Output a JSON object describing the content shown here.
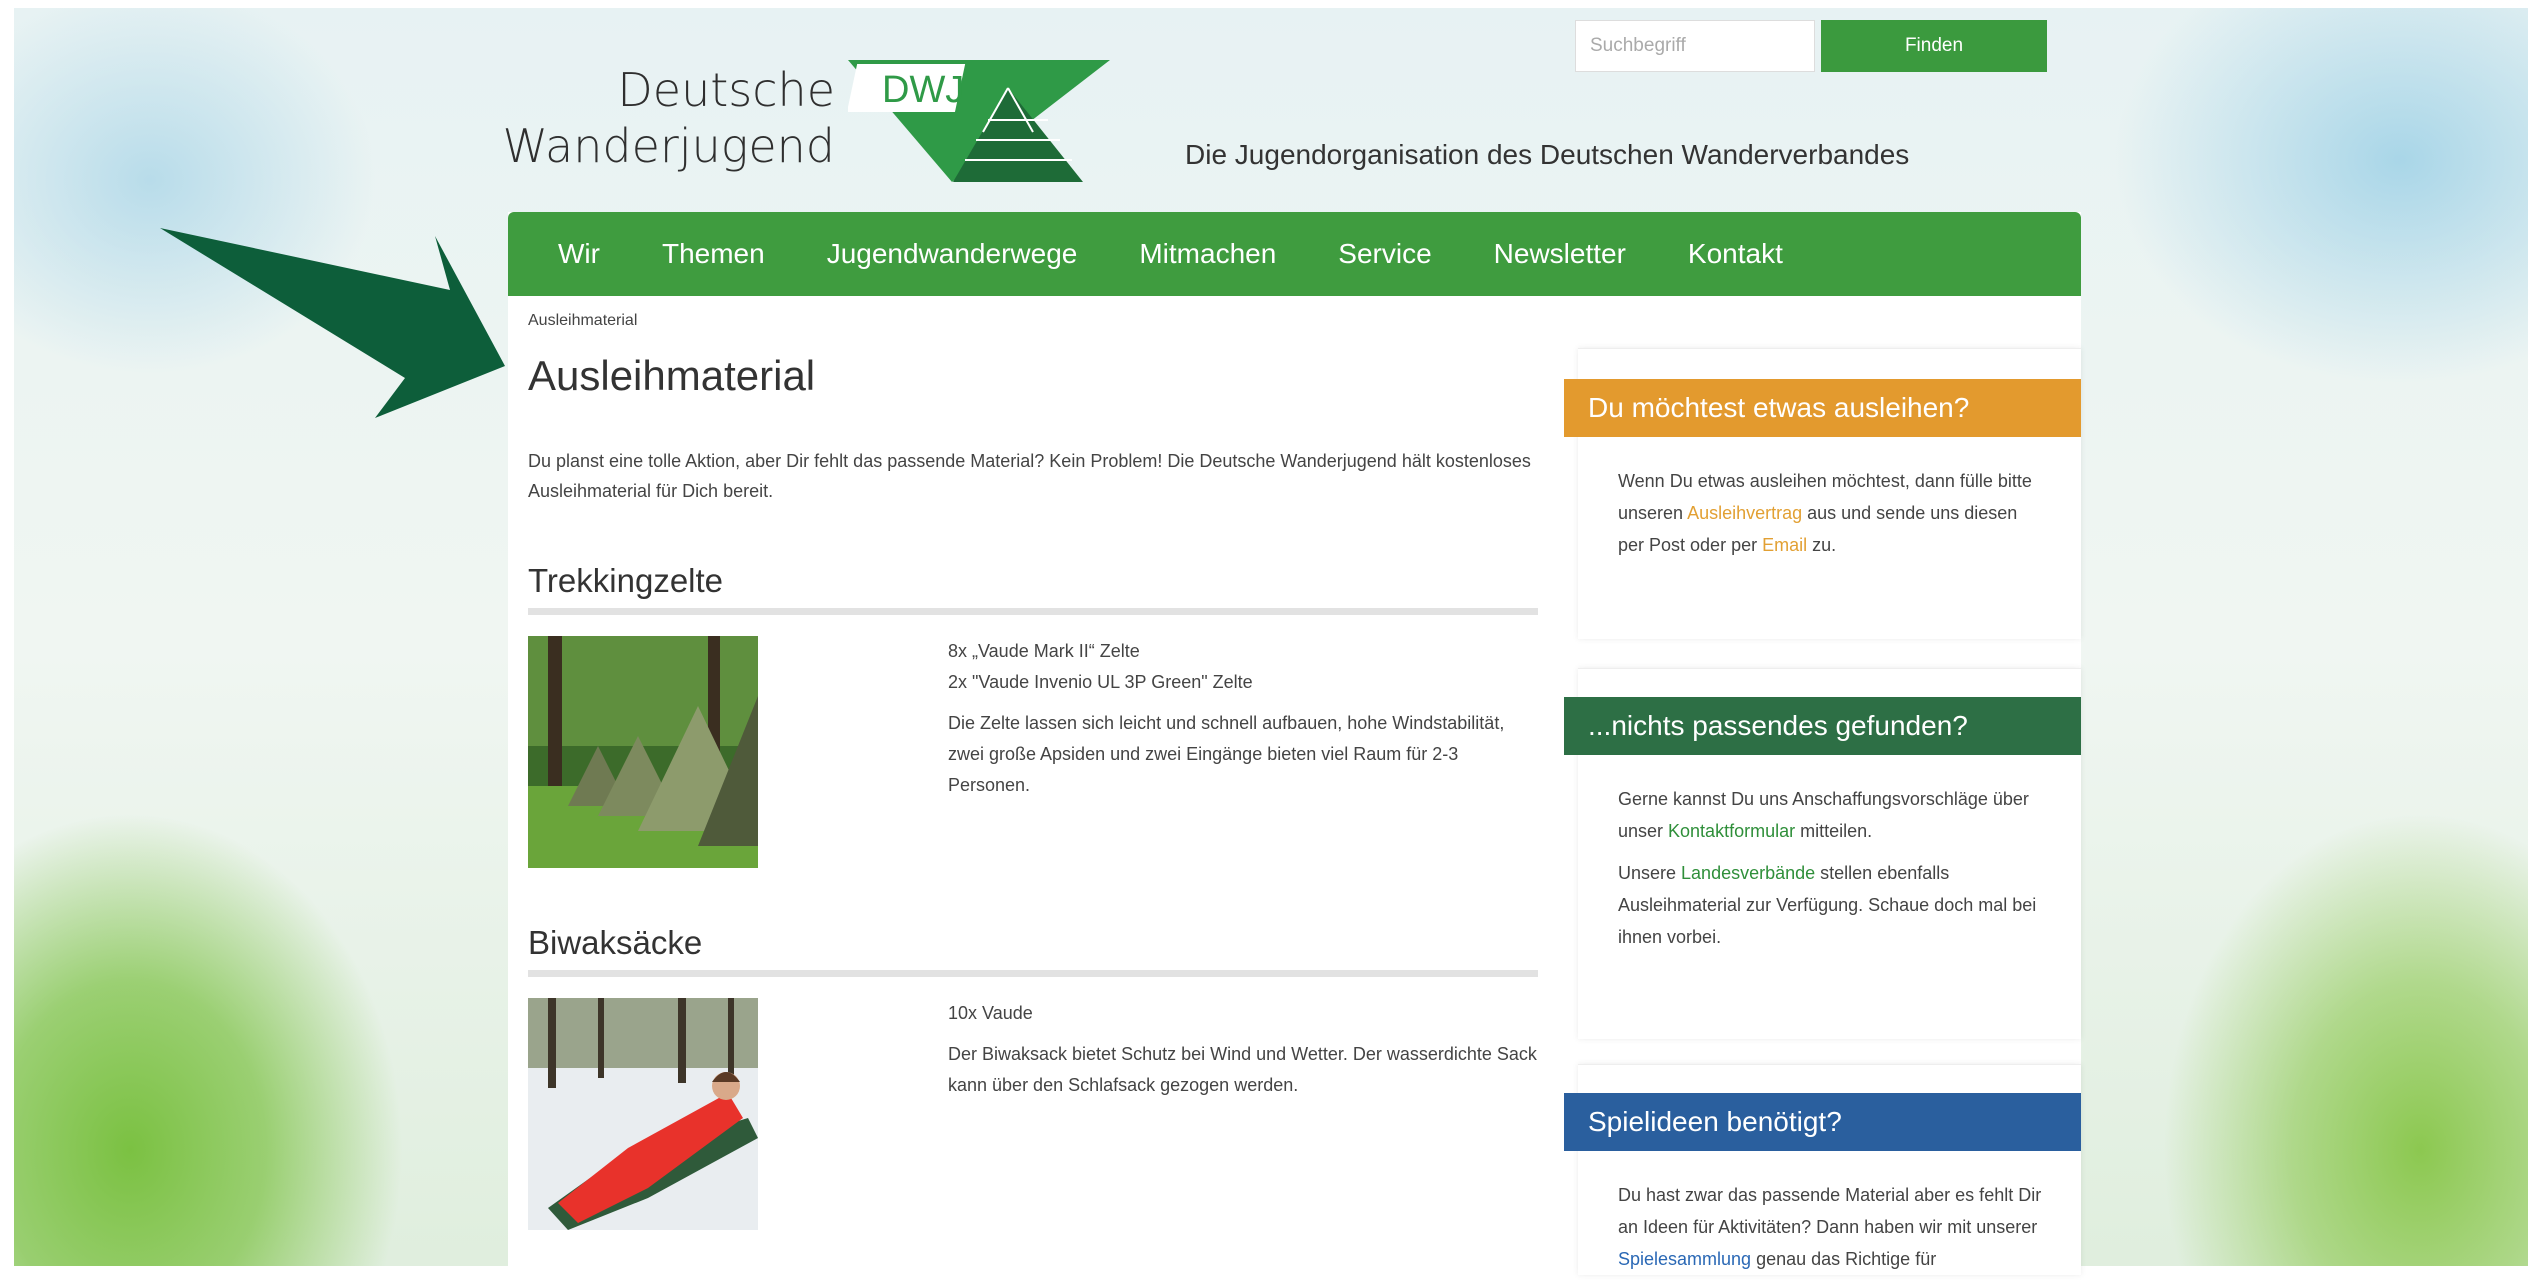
{
  "header": {
    "search_placeholder": "Suchbegriff",
    "search_button": "Finden",
    "logo_line1": "Deutsche",
    "logo_line2": "Wanderjugend",
    "logo_badge": "DWJ",
    "tagline": "Die Jugendorganisation des Deutschen Wanderverbandes"
  },
  "nav": {
    "items": [
      "Wir",
      "Themen",
      "Jugendwanderwege",
      "Mitmachen",
      "Service",
      "Newsletter",
      "Kontakt"
    ]
  },
  "main": {
    "breadcrumb": "Ausleihmaterial",
    "title": "Ausleihmaterial",
    "intro": "Du planst eine tolle Aktion, aber Dir fehlt das passende Material? Kein Problem! Die Deutsche Wanderjugend hält kostenloses Ausleihmaterial für Dich bereit.",
    "sections": [
      {
        "heading": "Trekkingzelte",
        "line1": "8x „Vaude Mark II“ Zelte",
        "line2": "2x \"Vaude Invenio UL 3P Green\" Zelte",
        "desc": "Die Zelte lassen sich leicht und schnell aufbauen, hohe Windstabilität, zwei große Apsiden und zwei Eingänge bieten viel Raum für 2-3 Personen."
      },
      {
        "heading": "Biwaksäcke",
        "line1": "10x Vaude",
        "desc": "Der Biwaksack bietet Schutz bei Wind und Wetter. Der wasserdichte Sack kann über den Schlafsack gezogen werden."
      }
    ]
  },
  "sidebar": {
    "box1": {
      "title": "Du möchtest etwas ausleihen?",
      "text_a": "Wenn Du etwas ausleihen möchtest, dann fülle bitte unseren ",
      "link1": "Ausleihvertrag",
      "text_b": " aus und sende uns diesen per Post oder per ",
      "link2": "Email",
      "text_c": " zu."
    },
    "box2": {
      "title": "...nichts passendes gefunden?",
      "p1_a": "Gerne kannst Du uns Anschaffungsvorschläge über unser ",
      "p1_link": "Kontaktformular",
      "p1_b": " mitteilen.",
      "p2_a": "Unsere ",
      "p2_link": "Landesverbände",
      "p2_b": " stellen ebenfalls Ausleihmaterial zur Verfügung. Schaue doch mal bei ihnen vorbei."
    },
    "box3": {
      "title": "Spielideen benötigt?",
      "text_a": "Du hast zwar das passende Material aber es fehlt Dir an Ideen für Aktivitäten? Dann haben wir mit unserer ",
      "link": "Spielesammlung",
      "text_b": " genau das Richtige für"
    }
  },
  "colors": {
    "nav_green": "#3f9c3f",
    "box1_orange": "#e39a2e",
    "box2_darkgreen": "#2d6f45",
    "box3_blue": "#2a5f9e",
    "arrow": "#0d5e3a"
  }
}
